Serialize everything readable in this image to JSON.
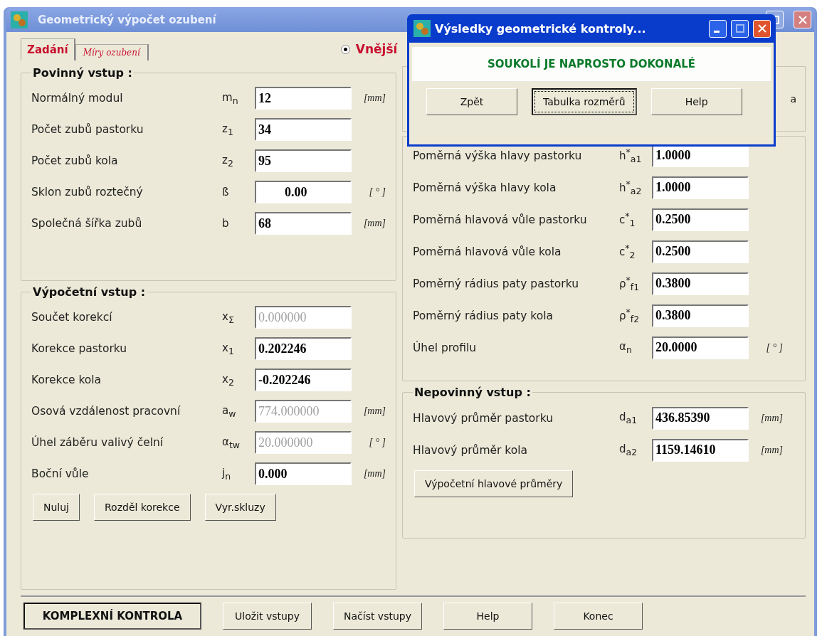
{
  "window": {
    "title": "Geometrický výpočet ozubení"
  },
  "tabs": [
    {
      "label": "Zadání",
      "selected": true
    },
    {
      "label": "Míry ozubení",
      "selected": false
    }
  ],
  "gear_type": {
    "label": "Vnější",
    "selected": true
  },
  "required_input": {
    "title": "Povinný vstup :",
    "rows": [
      {
        "label": "Normálný modul",
        "symbol": "m$_{n}$",
        "value": "12",
        "unit": "[mm]",
        "disabled": false,
        "centered": false
      },
      {
        "label": "Počet zubů pastorku",
        "symbol": "z$_{1}$",
        "value": "34",
        "disabled": false,
        "centered": false
      },
      {
        "label": "Počet zubů kola",
        "symbol": "z$_{2}$",
        "value": "95",
        "disabled": false,
        "centered": false
      },
      {
        "label": "Sklon zubů roztečný",
        "symbol": "ß",
        "value": "0.00",
        "unit": "[ ° ]",
        "disabled": false,
        "centered": true
      },
      {
        "label": "Společná šířka zubů",
        "symbol": "b",
        "value": "68",
        "unit": "[mm]",
        "disabled": false,
        "centered": false
      }
    ]
  },
  "computed_input": {
    "title": "Výpočetní vstup :",
    "rows": [
      {
        "label": "Součet korekcí",
        "symbol": "x$_{Σ}$",
        "value": "0.000000",
        "disabled": true,
        "centered": false
      },
      {
        "label": "Korekce pastorku",
        "symbol": "x$_{1}$",
        "value": "0.202246",
        "disabled": false,
        "centered": false
      },
      {
        "label": "Korekce kola",
        "symbol": "x$_{2}$",
        "value": "-0.202246",
        "disabled": false,
        "centered": false
      },
      {
        "label": "Osová vzdálenost pracovní",
        "symbol": "a$_{w}$",
        "value": "774.000000",
        "unit": "[mm]",
        "disabled": true,
        "centered": false
      },
      {
        "label": "Úhel záběru valivý čelní",
        "symbol": "α$_{tw}$",
        "value": "20.000000",
        "unit": "[ ° ]",
        "disabled": true,
        "centered": false
      },
      {
        "label": "Boční vůle",
        "symbol": "j$_{n}$",
        "value": "0.000",
        "unit": "[mm]",
        "disabled": false,
        "centered": false
      }
    ],
    "buttons": [
      "Nuluj",
      "Rozděl korekce",
      "Vyr.skluzy"
    ]
  },
  "hidden_panel": {
    "button_text": "a"
  },
  "coefficients": {
    "rows": [
      {
        "label": "Poměrná výška hlavy pastorku",
        "symbol": "h$^{*}$$_{a1}$",
        "value": "1.0000",
        "disabled": false,
        "centered": false
      },
      {
        "label": "Poměrná výška hlavy kola",
        "symbol": "h$^{*}$$_{a2}$",
        "value": "1.0000",
        "disabled": false,
        "centered": false
      },
      {
        "label": "Poměrná hlavová vůle pastorku",
        "symbol": "c$^{*}$$_{1}$",
        "value": "0.2500",
        "disabled": false,
        "centered": false
      },
      {
        "label": "Poměrná hlavová vůle kola",
        "symbol": "c$^{*}$$_{2}$",
        "value": "0.2500",
        "disabled": false,
        "centered": false
      },
      {
        "label": "Poměrný rádius paty pastorku",
        "symbol": "ρ$^{*}$$_{f1}$",
        "value": "0.3800",
        "disabled": false,
        "centered": false
      },
      {
        "label": "Poměrný rádius paty kola",
        "symbol": "ρ$^{*}$$_{f2}$",
        "value": "0.3800",
        "disabled": false,
        "centered": false
      },
      {
        "label": "Úhel profilu",
        "symbol": "α$_{n}$",
        "value": "20.0000",
        "unit": "[ ° ]",
        "disabled": false,
        "centered": false
      }
    ]
  },
  "optional_input": {
    "title": "Nepovinný vstup :",
    "rows": [
      {
        "label": "Hlavový průměr pastorku",
        "symbol": "d$_{a1}$",
        "value": "436.85390",
        "unit": "[mm]",
        "disabled": false,
        "centered": false
      },
      {
        "label": "Hlavový průměr kola",
        "symbol": "d$_{a2}$",
        "value": "1159.14610",
        "unit": "[mm]",
        "disabled": false,
        "centered": false
      }
    ],
    "button": "Výpočetní hlavové průměry"
  },
  "bottom_buttons": [
    {
      "label": "KOMPLEXNÍ KONTROLA",
      "kind": "primary"
    },
    {
      "label": "Uložit vstupy",
      "kind": "normal"
    },
    {
      "label": "Načíst vstupy",
      "kind": "normal"
    },
    {
      "label": "Help",
      "kind": "normal"
    },
    {
      "label": "Konec",
      "kind": "normal"
    }
  ],
  "dialog": {
    "title": "Výsledky geometrické kontroly...",
    "message": "SOUKOLÍ JE NAPROSTO DOKONALÉ",
    "buttons": [
      {
        "label": "Zpět",
        "focused": false
      },
      {
        "label": "Tabulka rozměrů",
        "focused": true
      },
      {
        "label": "Help",
        "focused": false
      }
    ]
  }
}
